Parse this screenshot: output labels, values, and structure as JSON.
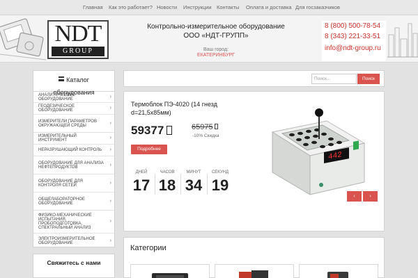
{
  "topnav": {
    "items": [
      "Главная",
      "Как это работает?",
      "Новости",
      "Инструкции",
      "Контакты",
      "Оплата и доставка",
      "Для госзаказчиков"
    ]
  },
  "header": {
    "logo": {
      "main": "NDT",
      "sub": "GROUP"
    },
    "tagline_line1": "Контрольно-измерительное оборудование",
    "tagline_line2": "ООО «НДТ-ГРУПП»",
    "city_label": "Ваш город:",
    "city": "ЕКАТЕРИНБУРГ",
    "phone1": "8 (800) 500-78-54",
    "phone2": "8 (343) 221-33-51",
    "email": "info@ndt-group.ru"
  },
  "sidebar": {
    "title_line1": "Каталог",
    "title_line2": "оборудования",
    "items": [
      {
        "label": "Аналитическое оборудование"
      },
      {
        "label": "Геодезическое оборудование"
      },
      {
        "label": "Измерители параметров окружающей среды"
      },
      {
        "label": "Измерительный инструмент"
      },
      {
        "label": "Неразрушающий контроль"
      },
      {
        "label": "Оборудование для анализа нефтепродуктов"
      },
      {
        "label": "Оборудование для контроля сетей"
      },
      {
        "label": "Общелабораторное оборудование"
      },
      {
        "label": "Физико-механические испытания, пробоподготовка, спектральный анализ"
      },
      {
        "label": "Электроизмерительное оборудование"
      }
    ],
    "contact_title": "Свяжитесь с нами"
  },
  "search": {
    "placeholder": "Поиск...",
    "button": "Поиск"
  },
  "promo": {
    "title": "Термоблок ПЭ-4020 (14 гнезд d=21,5х85мм)",
    "price": "59377",
    "old_price": "65975",
    "discount": "-10% Скидка",
    "button": "Подробнее",
    "countdown": [
      {
        "label": "Дней",
        "value": "17"
      },
      {
        "label": "Часов",
        "value": "18"
      },
      {
        "label": "Минут",
        "value": "34"
      },
      {
        "label": "Секунд",
        "value": "19"
      }
    ],
    "display_value": "442",
    "prev_arrow": "‹",
    "next_arrow": "›"
  },
  "categories": {
    "title": "Категории"
  },
  "colors": {
    "accent": "#d9534f",
    "page_bg": "#e2e2e2"
  }
}
